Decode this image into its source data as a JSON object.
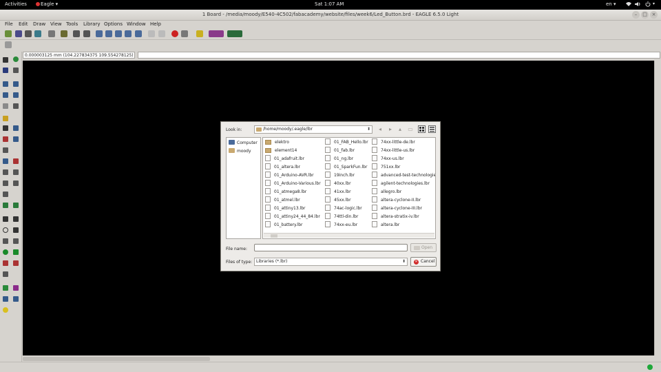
{
  "topbar": {
    "activities": "Activities",
    "app_menu": "Eagle ▾",
    "clock": "Sat  1:07 AM",
    "keyboard_layout": "en ▾",
    "icons": [
      "network-icon",
      "volume-icon",
      "power-icon"
    ]
  },
  "window": {
    "title": "1 Board - /media/moody/E540-4C502/fabacademy/website/files/week6/Led_Button.brd - EAGLE 6.5.0 Light",
    "buttons": [
      "minimize",
      "maximize",
      "close"
    ]
  },
  "menubar": [
    "File",
    "Edit",
    "Draw",
    "View",
    "Tools",
    "Library",
    "Options",
    "Window",
    "Help"
  ],
  "coord": {
    "readout": "0.000003125 mm (104.227834375 109.554278125)"
  },
  "colors": {
    "canvas": "#000000",
    "status_ok": "#1fa83a",
    "cancel": "#d12a2a"
  },
  "dialog": {
    "look_in_label": "Look in:",
    "look_in_value": "/home/moody/.eagle/lbr",
    "places": [
      "Computer",
      "moody"
    ],
    "files": [
      [
        "elektro",
        "element14",
        "01_adafruit.lbr",
        "01_altera.lbr",
        "01_Arduino-AVR.lbr",
        "01_Arduino-Various.lbr",
        "01_atmega8.lbr",
        "01_atmel.lbr",
        "01_attiny13.lbr",
        "01_attiny24_44_84.lbr",
        "01_battery.lbr"
      ],
      [
        "01_FAB_Hello.lbr",
        "01_fab.lbr",
        "01_ng.lbr",
        "01_SparkFun.lbr",
        "19inch.lbr",
        "40xx.lbr",
        "41xx.lbr",
        "45xx.lbr",
        "74ac-logic.lbr",
        "74ttl-din.lbr",
        "74xx-eu.lbr"
      ],
      [
        "74xx-little-de.lbr",
        "74xx-little-us.lbr",
        "74xx-us.lbr",
        "751xx.lbr",
        "advanced-test-technologie",
        "agilent-technologies.lbr",
        "allegro.lbr",
        "altera-cyclone-II.lbr",
        "altera-cyclone-III.lbr",
        "altera-stratix-iv.lbr",
        "altera.lbr"
      ]
    ],
    "file_name_label": "File name:",
    "file_name_value": "",
    "open_label": "Open",
    "file_type_label": "Files of type:",
    "file_type_value": "Libraries (*.lbr)",
    "cancel_label": "Cancel"
  }
}
